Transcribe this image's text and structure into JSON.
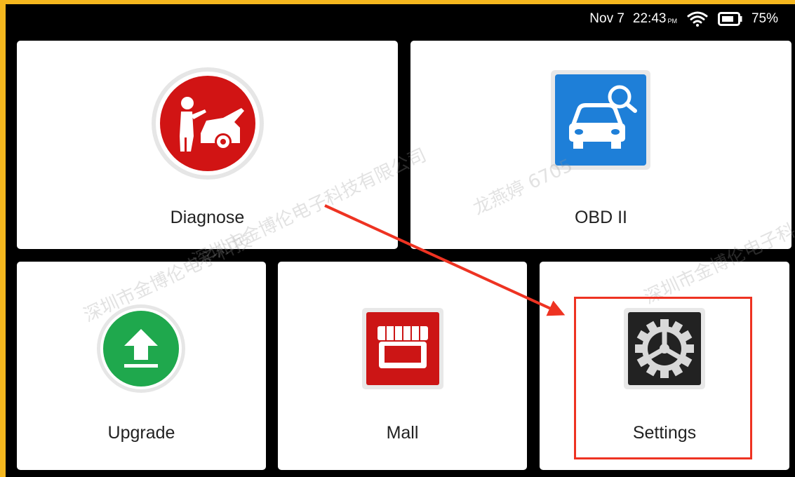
{
  "status_bar": {
    "date": "Nov 7",
    "time": "22:43",
    "ampm": "PM",
    "battery": "75%"
  },
  "tiles": [
    {
      "label": "Diagnose",
      "icon": "mechanic-car-icon",
      "color": "#d11414"
    },
    {
      "label": "OBD II",
      "icon": "car-search-icon",
      "color": "#1e7fd8"
    },
    {
      "label": "Upgrade",
      "icon": "upload-icon",
      "color": "#1fa84d"
    },
    {
      "label": "Mall",
      "icon": "storefront-icon",
      "color": "#cc1515"
    },
    {
      "label": "Settings",
      "icon": "gear-icon",
      "color": "#222222"
    }
  ],
  "watermarks": [
    "深圳市金博伦电子科技有限公司",
    "龙燕婷 6705",
    "深圳市金博伦电子科技",
    "深圳市金博伦电子科"
  ],
  "annotation_color": "#ee3322"
}
